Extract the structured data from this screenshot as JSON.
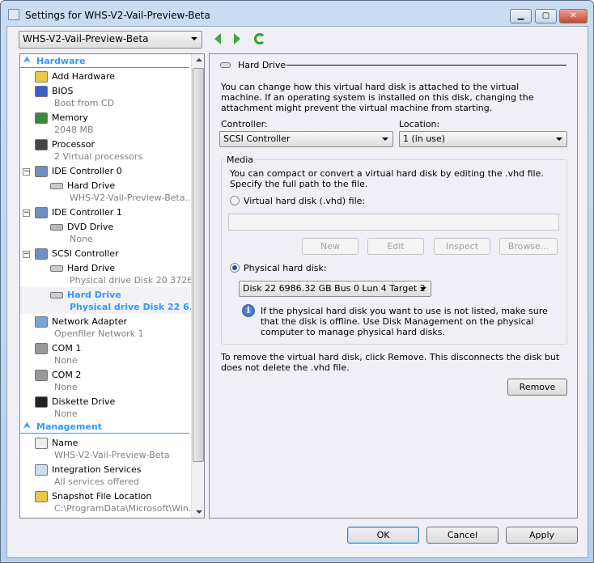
{
  "window": {
    "title": "Settings for WHS-V2-Vail-Preview-Beta",
    "minimize": "▁",
    "maximize": "▢",
    "close": "✕"
  },
  "vm_selector": "WHS-V2-Vail-Preview-Beta",
  "sidebar": {
    "hardware_label": "Hardware",
    "management_label": "Management",
    "items": [
      {
        "label": "Add Hardware",
        "sub": ""
      },
      {
        "label": "BIOS",
        "sub": "Boot from CD"
      },
      {
        "label": "Memory",
        "sub": "2048 MB"
      },
      {
        "label": "Processor",
        "sub": "2 Virtual processors"
      },
      {
        "label": "IDE Controller 0",
        "sub": ""
      },
      {
        "label": "Hard Drive",
        "sub": "WHS-V2-Vail-Preview-Beta...."
      },
      {
        "label": "IDE Controller 1",
        "sub": ""
      },
      {
        "label": "DVD Drive",
        "sub": "None"
      },
      {
        "label": "SCSI Controller",
        "sub": ""
      },
      {
        "label": "Hard Drive",
        "sub": "Physical drive Disk 20 3726..."
      },
      {
        "label": "Hard Drive",
        "sub": "Physical drive Disk 22 6..."
      },
      {
        "label": "Network Adapter",
        "sub": "Openfiler Network 1"
      },
      {
        "label": "COM 1",
        "sub": "None"
      },
      {
        "label": "COM 2",
        "sub": "None"
      },
      {
        "label": "Diskette Drive",
        "sub": "None"
      },
      {
        "label": "Name",
        "sub": "WHS-V2-Vail-Preview-Beta"
      },
      {
        "label": "Integration Services",
        "sub": "All services offered"
      },
      {
        "label": "Snapshot File Location",
        "sub": "C:\\ProgramData\\Microsoft\\Win..."
      }
    ]
  },
  "detail": {
    "header": "Hard Drive",
    "intro": "You can change how this virtual hard disk is attached to the virtual machine. If an operating system is installed on this disk, changing the attachment might prevent the virtual machine from starting.",
    "controller_label": "Controller:",
    "controller_value": "SCSI Controller",
    "location_label": "Location:",
    "location_value": "1 (in use)",
    "media_label": "Media",
    "media_text": "You can compact or convert a virtual hard disk by editing the .vhd file. Specify the full path to the file.",
    "vhd_radio": "Virtual hard disk (.vhd) file:",
    "vhd_path": "",
    "buttons": {
      "new": "New",
      "edit": "Edit",
      "inspect": "Inspect",
      "browse": "Browse..."
    },
    "physical_radio": "Physical hard disk:",
    "physical_value": "Disk 22 6986.32 GB Bus 0 Lun 4 Target 2",
    "info_text": "If the physical hard disk you want to use is not listed, make sure that the disk is offline. Use Disk Management on the physical computer to manage physical hard disks.",
    "remove_text": "To remove the virtual hard disk, click Remove. This disconnects the disk but does not delete the .vhd file.",
    "remove_button": "Remove"
  },
  "footer": {
    "ok": "OK",
    "cancel": "Cancel",
    "apply": "Apply"
  }
}
